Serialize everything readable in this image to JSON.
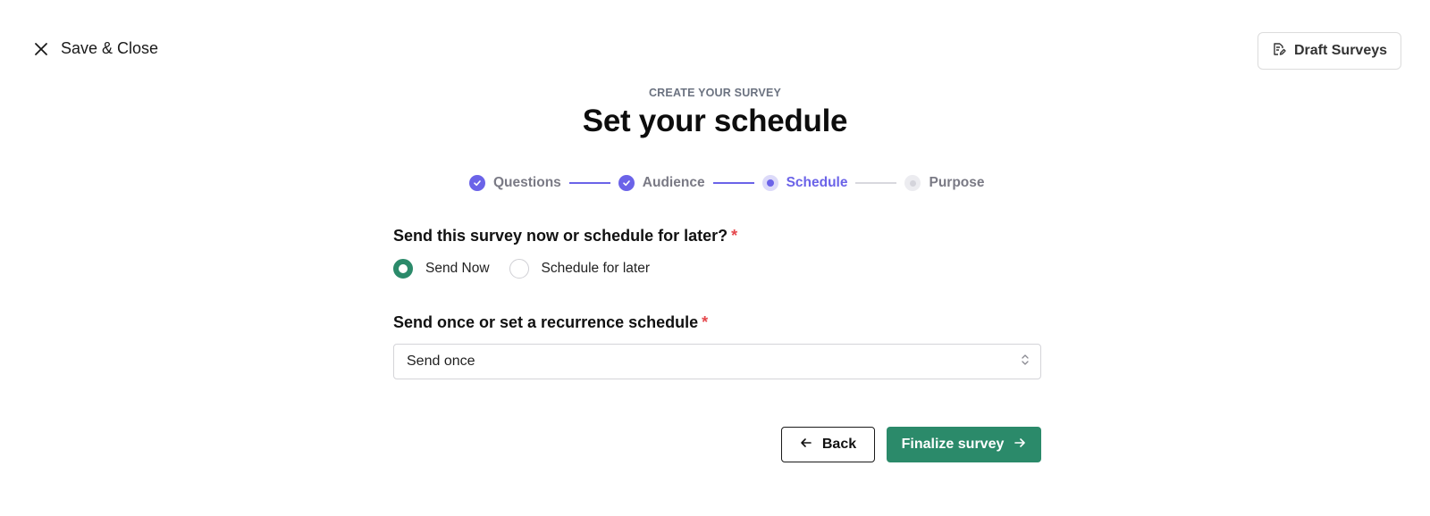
{
  "header": {
    "save_close_label": "Save & Close",
    "draft_surveys_label": "Draft Surveys"
  },
  "page": {
    "eyebrow": "CREATE YOUR SURVEY",
    "title": "Set your schedule"
  },
  "stepper": {
    "steps": [
      {
        "label": "Questions",
        "status": "complete"
      },
      {
        "label": "Audience",
        "status": "complete"
      },
      {
        "label": "Schedule",
        "status": "current"
      },
      {
        "label": "Purpose",
        "status": "upcoming"
      }
    ]
  },
  "form": {
    "send_timing": {
      "question": "Send this survey now or schedule for later?",
      "required_marker": "*",
      "options": [
        "Send Now",
        "Schedule for later"
      ],
      "selected": "Send Now"
    },
    "recurrence": {
      "question": "Send once or set a recurrence schedule",
      "required_marker": "*",
      "selected_value": "Send once"
    }
  },
  "actions": {
    "back_label": "Back",
    "finalize_label": "Finalize survey"
  },
  "colors": {
    "accent_purple": "#6b63e8",
    "primary_green": "#2b8a6a",
    "required_red": "#e5484d"
  }
}
